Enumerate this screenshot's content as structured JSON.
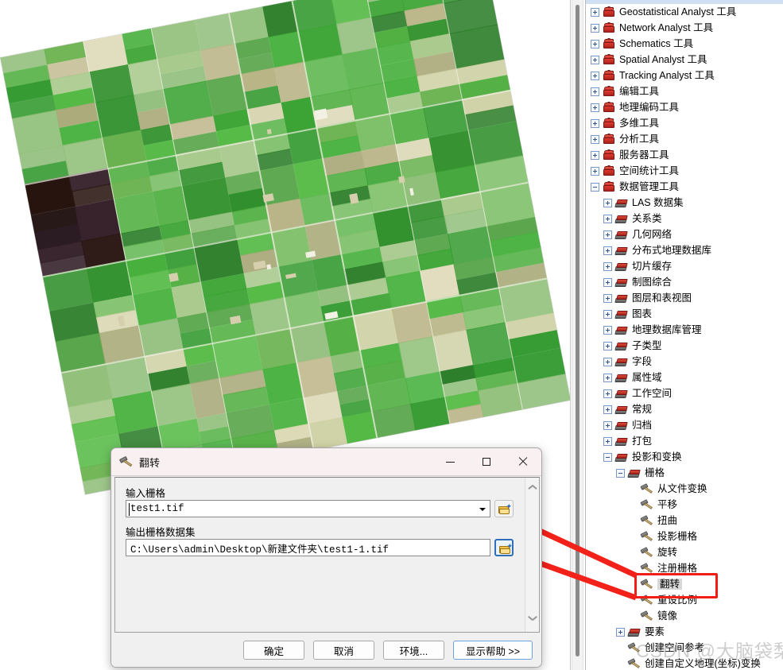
{
  "app": {
    "map_view_name": "map-data-view",
    "raster_layer_name": "test1.tif"
  },
  "toolbox_panel": {
    "scrollbar_name": "toolbox-scrollbar",
    "items": [
      {
        "label": "Geostatistical Analyst 工具",
        "level": 0,
        "icon": "toolbox-icon",
        "state": "collapsed"
      },
      {
        "label": "Network Analyst 工具",
        "level": 0,
        "icon": "toolbox-icon",
        "state": "collapsed"
      },
      {
        "label": "Schematics 工具",
        "level": 0,
        "icon": "toolbox-icon",
        "state": "collapsed"
      },
      {
        "label": "Spatial Analyst 工具",
        "level": 0,
        "icon": "toolbox-icon",
        "state": "collapsed"
      },
      {
        "label": "Tracking Analyst 工具",
        "level": 0,
        "icon": "toolbox-icon",
        "state": "collapsed"
      },
      {
        "label": "编辑工具",
        "level": 0,
        "icon": "toolbox-icon",
        "state": "collapsed"
      },
      {
        "label": "地理编码工具",
        "level": 0,
        "icon": "toolbox-icon",
        "state": "collapsed"
      },
      {
        "label": "多维工具",
        "level": 0,
        "icon": "toolbox-icon",
        "state": "collapsed"
      },
      {
        "label": "分析工具",
        "level": 0,
        "icon": "toolbox-icon",
        "state": "collapsed"
      },
      {
        "label": "服务器工具",
        "level": 0,
        "icon": "toolbox-icon",
        "state": "collapsed"
      },
      {
        "label": "空间统计工具",
        "level": 0,
        "icon": "toolbox-icon",
        "state": "collapsed"
      },
      {
        "label": "数据管理工具",
        "level": 0,
        "icon": "toolbox-icon",
        "state": "expanded"
      },
      {
        "label": "LAS 数据集",
        "level": 1,
        "icon": "toolset-icon",
        "state": "collapsed"
      },
      {
        "label": "关系类",
        "level": 1,
        "icon": "toolset-icon",
        "state": "collapsed"
      },
      {
        "label": "几何网络",
        "level": 1,
        "icon": "toolset-icon",
        "state": "collapsed"
      },
      {
        "label": "分布式地理数据库",
        "level": 1,
        "icon": "toolset-icon",
        "state": "collapsed"
      },
      {
        "label": "切片缓存",
        "level": 1,
        "icon": "toolset-icon",
        "state": "collapsed"
      },
      {
        "label": "制图综合",
        "level": 1,
        "icon": "toolset-icon",
        "state": "collapsed"
      },
      {
        "label": "图层和表视图",
        "level": 1,
        "icon": "toolset-icon",
        "state": "collapsed"
      },
      {
        "label": "图表",
        "level": 1,
        "icon": "toolset-icon",
        "state": "collapsed"
      },
      {
        "label": "地理数据库管理",
        "level": 1,
        "icon": "toolset-icon",
        "state": "collapsed"
      },
      {
        "label": "子类型",
        "level": 1,
        "icon": "toolset-icon",
        "state": "collapsed"
      },
      {
        "label": "字段",
        "level": 1,
        "icon": "toolset-icon",
        "state": "collapsed"
      },
      {
        "label": "属性域",
        "level": 1,
        "icon": "toolset-icon",
        "state": "collapsed"
      },
      {
        "label": "工作空间",
        "level": 1,
        "icon": "toolset-icon",
        "state": "collapsed"
      },
      {
        "label": "常规",
        "level": 1,
        "icon": "toolset-icon",
        "state": "collapsed"
      },
      {
        "label": "归档",
        "level": 1,
        "icon": "toolset-icon",
        "state": "collapsed"
      },
      {
        "label": "打包",
        "level": 1,
        "icon": "toolset-icon",
        "state": "collapsed"
      },
      {
        "label": "投影和变换",
        "level": 1,
        "icon": "toolset-icon",
        "state": "expanded"
      },
      {
        "label": "栅格",
        "level": 2,
        "icon": "toolset-icon",
        "state": "expanded"
      },
      {
        "label": "从文件变换",
        "level": 3,
        "icon": "tool-icon",
        "state": "leaf"
      },
      {
        "label": "平移",
        "level": 3,
        "icon": "tool-icon",
        "state": "leaf"
      },
      {
        "label": "扭曲",
        "level": 3,
        "icon": "tool-icon",
        "state": "leaf"
      },
      {
        "label": "投影栅格",
        "level": 3,
        "icon": "tool-icon",
        "state": "leaf"
      },
      {
        "label": "旋转",
        "level": 3,
        "icon": "tool-icon",
        "state": "leaf"
      },
      {
        "label": "注册栅格",
        "level": 3,
        "icon": "tool-icon",
        "state": "leaf"
      },
      {
        "label": "翻转",
        "level": 3,
        "icon": "tool-icon",
        "state": "leaf",
        "selected": true
      },
      {
        "label": "重设比例",
        "level": 3,
        "icon": "tool-icon",
        "state": "leaf"
      },
      {
        "label": "镜像",
        "level": 3,
        "icon": "tool-icon",
        "state": "leaf"
      },
      {
        "label": "要素",
        "level": 2,
        "icon": "toolset-icon",
        "state": "collapsed"
      },
      {
        "label": "创建空间参考",
        "level": 2,
        "icon": "tool-icon",
        "state": "leaf"
      },
      {
        "label": "创建自定义地理(坐标)变换",
        "level": 2,
        "icon": "tool-icon",
        "state": "leaf"
      }
    ]
  },
  "annotations": {
    "highlight_color": "#f01e14",
    "arrow_color": "#f2221a",
    "highlighted_item": "翻转"
  },
  "dialog": {
    "title": "翻转",
    "title_icon": "tool-icon",
    "window_buttons": {
      "minimize": "minimize-icon",
      "maximize": "maximize-icon",
      "close": "close-icon"
    },
    "fields": [
      {
        "label": "输入栅格",
        "value": "test1.tif",
        "type": "combobox",
        "browse_icon": "folder-browse-icon",
        "focused": false
      },
      {
        "label": "输出栅格数据集",
        "value": "C:\\Users\\admin\\Desktop\\新建文件夹\\test1-1.tif",
        "type": "textbox",
        "browse_icon": "folder-browse-icon",
        "focused": true
      }
    ],
    "buttons": [
      {
        "label": "确定",
        "primary": false
      },
      {
        "label": "取消",
        "primary": false
      },
      {
        "label": "环境...",
        "primary": false
      },
      {
        "label": "显示帮助 >>",
        "primary": true
      }
    ]
  },
  "watermark": {
    "text": "CSDN @大脑袋梨"
  }
}
